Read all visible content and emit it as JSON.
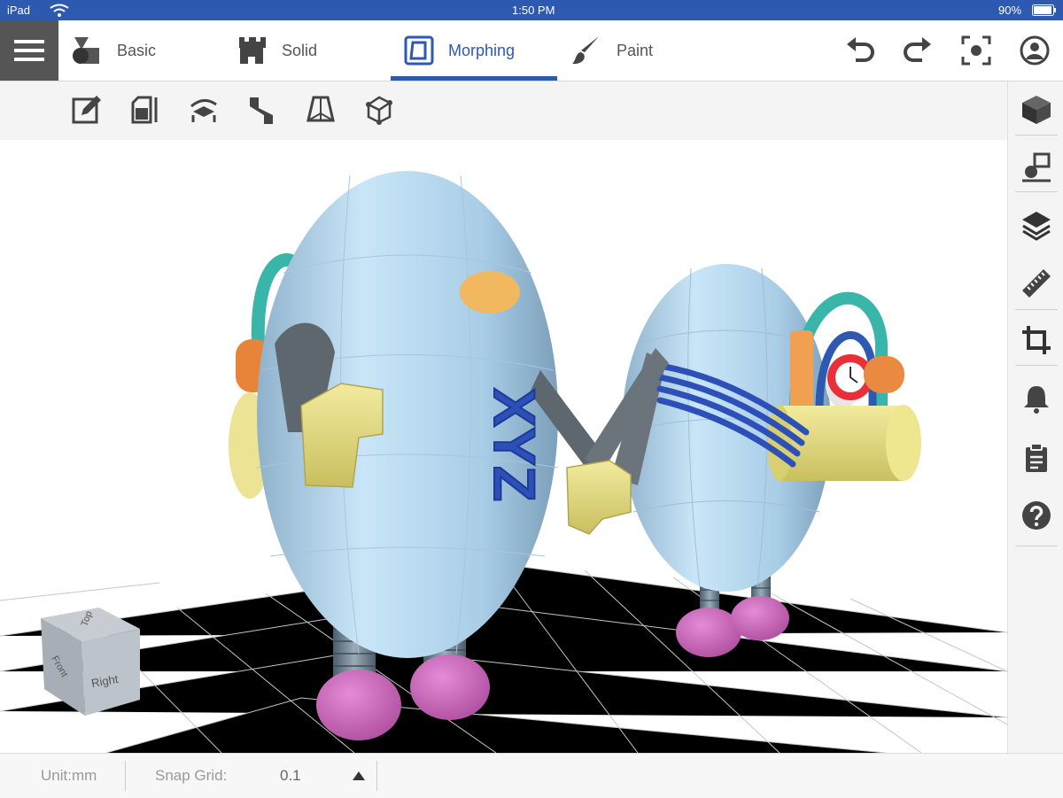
{
  "statusbar": {
    "device": "iPad",
    "time": "1:50 PM",
    "battery": "90%"
  },
  "tabs": [
    {
      "label": "Basic",
      "icon": "shapes-icon"
    },
    {
      "label": "Solid",
      "icon": "castle-icon"
    },
    {
      "label": "Morphing",
      "icon": "morph-square-icon"
    },
    {
      "label": "Paint",
      "icon": "paintbrush-icon"
    }
  ],
  "active_tab": "Morphing",
  "toolbar_right_icons": [
    "undo-icon",
    "redo-icon",
    "focus-icon",
    "account-icon"
  ],
  "morph_tools": [
    "edit-icon",
    "extrude-icon",
    "twist-icon",
    "bend-icon",
    "taper-icon",
    "lattice-icon"
  ],
  "sidebar_icons": [
    "cube-icon",
    "shape-import-icon",
    "layers-icon",
    "ruler-icon",
    "crop-icon",
    "bell-icon",
    "clipboard-icon",
    "help-icon"
  ],
  "view_cube": {
    "top": "Top",
    "front": "Front",
    "right": "Right"
  },
  "model_text": "XYZ",
  "bottombar": {
    "unit_label": "Unit:mm",
    "snap_label": "Snap Grid:",
    "snap_value": "0.1"
  },
  "colors": {
    "accent": "#2d5ab0",
    "body": "#b9dcf2",
    "feet": "#d36fc4",
    "hands": "#e9df8c"
  }
}
